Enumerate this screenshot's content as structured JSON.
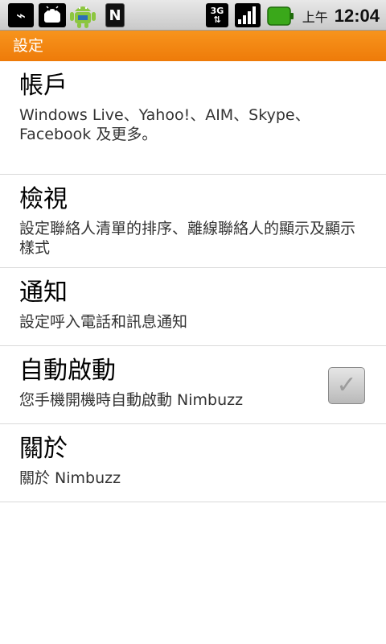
{
  "status_bar": {
    "ampm": "上午",
    "time": "12:04",
    "network_label_top": "3G",
    "network_label_bottom": "⇅",
    "icons": [
      "usb-icon",
      "android-debug-icon",
      "android-market-icon",
      "nimbuzz-n-icon",
      "network-3g-icon",
      "signal-icon",
      "battery-icon"
    ],
    "n_label": "N"
  },
  "title_bar": {
    "title": "設定",
    "color": "#f58a14"
  },
  "settings": {
    "items": [
      {
        "title": "帳戶",
        "summary": "Windows Live、Yahoo!、AIM、Skype、Facebook 及更多。"
      },
      {
        "title": "檢視",
        "summary": "設定聯絡人清單的排序、離線聯絡人的顯示及顯示樣式"
      },
      {
        "title": "通知",
        "summary": "設定呼入電話和訊息通知"
      },
      {
        "title": "自動啟動",
        "summary": "您手機開機時自動啟動 Nimbuzz",
        "checked": true
      },
      {
        "title": "關於",
        "summary": "關於 Nimbuzz"
      }
    ]
  }
}
